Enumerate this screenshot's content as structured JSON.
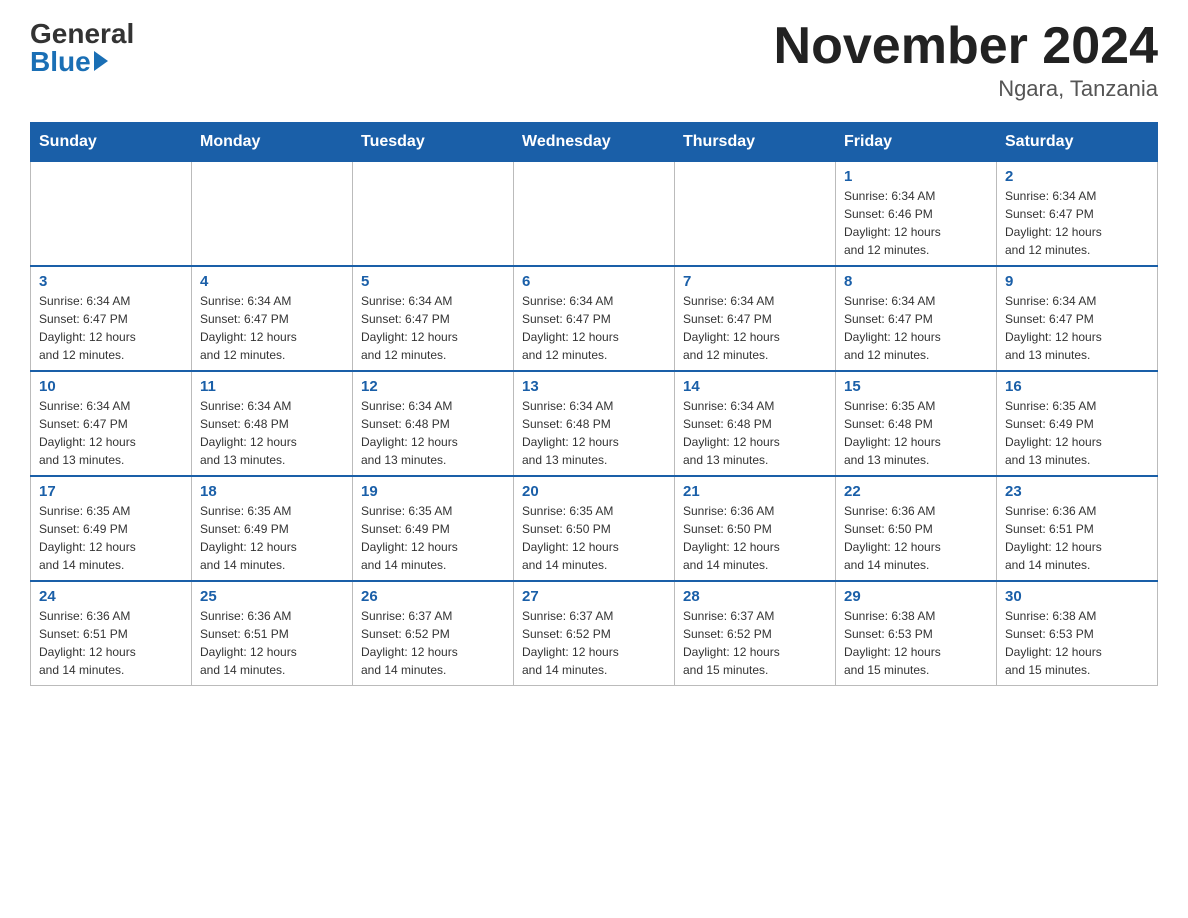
{
  "header": {
    "logo": {
      "general": "General",
      "blue": "Blue"
    },
    "title": "November 2024",
    "location": "Ngara, Tanzania"
  },
  "weekdays": [
    "Sunday",
    "Monday",
    "Tuesday",
    "Wednesday",
    "Thursday",
    "Friday",
    "Saturday"
  ],
  "weeks": [
    [
      {
        "day": "",
        "info": ""
      },
      {
        "day": "",
        "info": ""
      },
      {
        "day": "",
        "info": ""
      },
      {
        "day": "",
        "info": ""
      },
      {
        "day": "",
        "info": ""
      },
      {
        "day": "1",
        "info": "Sunrise: 6:34 AM\nSunset: 6:46 PM\nDaylight: 12 hours\nand 12 minutes."
      },
      {
        "day": "2",
        "info": "Sunrise: 6:34 AM\nSunset: 6:47 PM\nDaylight: 12 hours\nand 12 minutes."
      }
    ],
    [
      {
        "day": "3",
        "info": "Sunrise: 6:34 AM\nSunset: 6:47 PM\nDaylight: 12 hours\nand 12 minutes."
      },
      {
        "day": "4",
        "info": "Sunrise: 6:34 AM\nSunset: 6:47 PM\nDaylight: 12 hours\nand 12 minutes."
      },
      {
        "day": "5",
        "info": "Sunrise: 6:34 AM\nSunset: 6:47 PM\nDaylight: 12 hours\nand 12 minutes."
      },
      {
        "day": "6",
        "info": "Sunrise: 6:34 AM\nSunset: 6:47 PM\nDaylight: 12 hours\nand 12 minutes."
      },
      {
        "day": "7",
        "info": "Sunrise: 6:34 AM\nSunset: 6:47 PM\nDaylight: 12 hours\nand 12 minutes."
      },
      {
        "day": "8",
        "info": "Sunrise: 6:34 AM\nSunset: 6:47 PM\nDaylight: 12 hours\nand 12 minutes."
      },
      {
        "day": "9",
        "info": "Sunrise: 6:34 AM\nSunset: 6:47 PM\nDaylight: 12 hours\nand 13 minutes."
      }
    ],
    [
      {
        "day": "10",
        "info": "Sunrise: 6:34 AM\nSunset: 6:47 PM\nDaylight: 12 hours\nand 13 minutes."
      },
      {
        "day": "11",
        "info": "Sunrise: 6:34 AM\nSunset: 6:48 PM\nDaylight: 12 hours\nand 13 minutes."
      },
      {
        "day": "12",
        "info": "Sunrise: 6:34 AM\nSunset: 6:48 PM\nDaylight: 12 hours\nand 13 minutes."
      },
      {
        "day": "13",
        "info": "Sunrise: 6:34 AM\nSunset: 6:48 PM\nDaylight: 12 hours\nand 13 minutes."
      },
      {
        "day": "14",
        "info": "Sunrise: 6:34 AM\nSunset: 6:48 PM\nDaylight: 12 hours\nand 13 minutes."
      },
      {
        "day": "15",
        "info": "Sunrise: 6:35 AM\nSunset: 6:48 PM\nDaylight: 12 hours\nand 13 minutes."
      },
      {
        "day": "16",
        "info": "Sunrise: 6:35 AM\nSunset: 6:49 PM\nDaylight: 12 hours\nand 13 minutes."
      }
    ],
    [
      {
        "day": "17",
        "info": "Sunrise: 6:35 AM\nSunset: 6:49 PM\nDaylight: 12 hours\nand 14 minutes."
      },
      {
        "day": "18",
        "info": "Sunrise: 6:35 AM\nSunset: 6:49 PM\nDaylight: 12 hours\nand 14 minutes."
      },
      {
        "day": "19",
        "info": "Sunrise: 6:35 AM\nSunset: 6:49 PM\nDaylight: 12 hours\nand 14 minutes."
      },
      {
        "day": "20",
        "info": "Sunrise: 6:35 AM\nSunset: 6:50 PM\nDaylight: 12 hours\nand 14 minutes."
      },
      {
        "day": "21",
        "info": "Sunrise: 6:36 AM\nSunset: 6:50 PM\nDaylight: 12 hours\nand 14 minutes."
      },
      {
        "day": "22",
        "info": "Sunrise: 6:36 AM\nSunset: 6:50 PM\nDaylight: 12 hours\nand 14 minutes."
      },
      {
        "day": "23",
        "info": "Sunrise: 6:36 AM\nSunset: 6:51 PM\nDaylight: 12 hours\nand 14 minutes."
      }
    ],
    [
      {
        "day": "24",
        "info": "Sunrise: 6:36 AM\nSunset: 6:51 PM\nDaylight: 12 hours\nand 14 minutes."
      },
      {
        "day": "25",
        "info": "Sunrise: 6:36 AM\nSunset: 6:51 PM\nDaylight: 12 hours\nand 14 minutes."
      },
      {
        "day": "26",
        "info": "Sunrise: 6:37 AM\nSunset: 6:52 PM\nDaylight: 12 hours\nand 14 minutes."
      },
      {
        "day": "27",
        "info": "Sunrise: 6:37 AM\nSunset: 6:52 PM\nDaylight: 12 hours\nand 14 minutes."
      },
      {
        "day": "28",
        "info": "Sunrise: 6:37 AM\nSunset: 6:52 PM\nDaylight: 12 hours\nand 15 minutes."
      },
      {
        "day": "29",
        "info": "Sunrise: 6:38 AM\nSunset: 6:53 PM\nDaylight: 12 hours\nand 15 minutes."
      },
      {
        "day": "30",
        "info": "Sunrise: 6:38 AM\nSunset: 6:53 PM\nDaylight: 12 hours\nand 15 minutes."
      }
    ]
  ]
}
